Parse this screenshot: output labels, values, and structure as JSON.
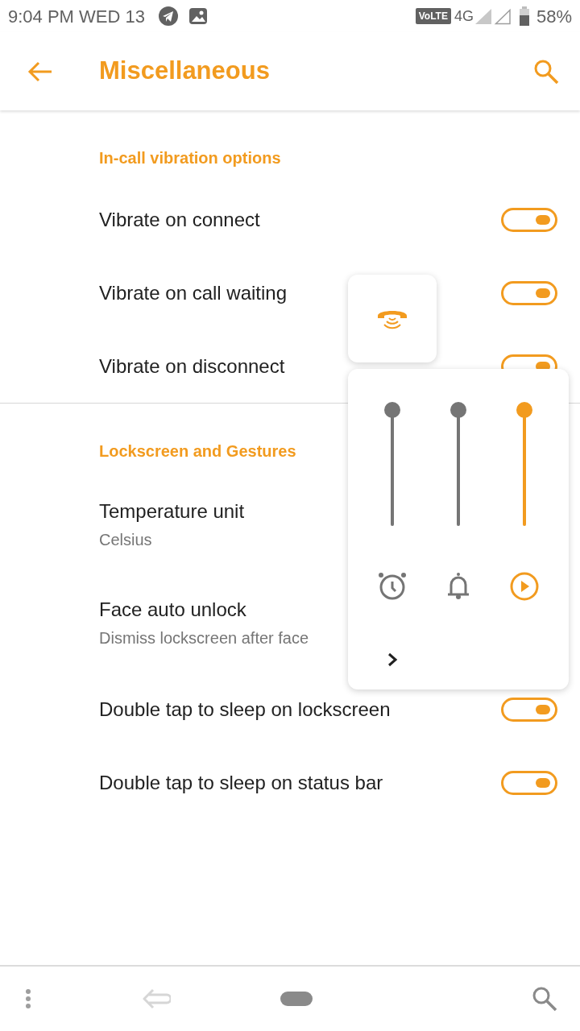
{
  "status_bar": {
    "time": "9:04 PM WED 13",
    "network_badge": "VoLTE",
    "network": "4G",
    "battery": "58%"
  },
  "app_bar": {
    "title": "Miscellaneous"
  },
  "sections": [
    {
      "title": "In-call vibration options",
      "items": [
        {
          "kind": "switch",
          "title": "Vibrate on connect",
          "on": true
        },
        {
          "kind": "switch",
          "title": "Vibrate on call waiting",
          "on": true
        },
        {
          "kind": "switch",
          "title": "Vibrate on disconnect",
          "on": true
        }
      ]
    },
    {
      "title": "Lockscreen and Gestures",
      "items": [
        {
          "kind": "text",
          "title": "Temperature unit",
          "subtitle": "Celsius"
        },
        {
          "kind": "text",
          "title": "Face auto unlock",
          "subtitle": "Dismiss lockscreen after face"
        },
        {
          "kind": "switch",
          "title": "Double tap to sleep on lockscreen",
          "on": true
        },
        {
          "kind": "switch",
          "title": "Double tap to sleep on status bar",
          "on": true
        }
      ]
    }
  ],
  "volume_panel": {
    "sliders": [
      {
        "kind": "alarm",
        "level": 1,
        "selected": false
      },
      {
        "kind": "ring",
        "level": 1,
        "selected": false
      },
      {
        "kind": "media",
        "level": 1,
        "selected": true
      }
    ]
  }
}
